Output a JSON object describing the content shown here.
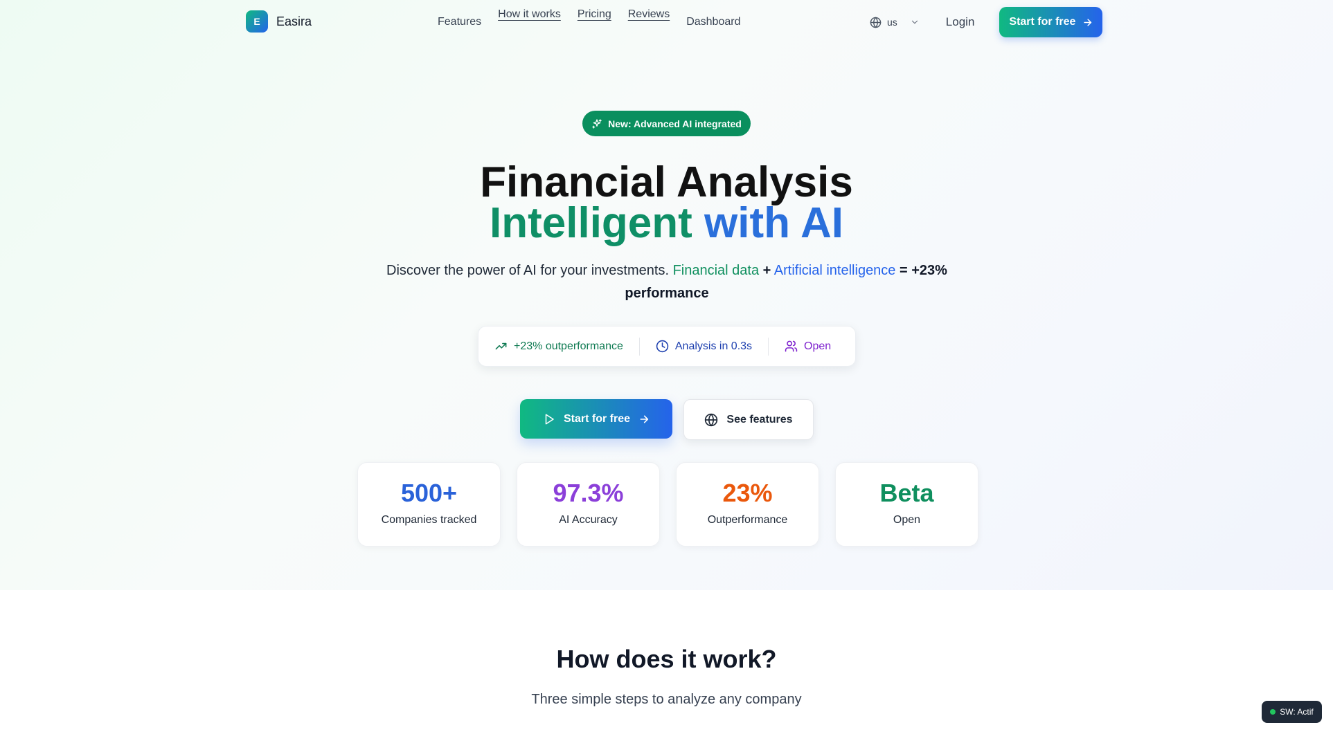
{
  "nav": {
    "brand_initial": "E",
    "brand_name": "Easira",
    "links": [
      {
        "label": "Features"
      },
      {
        "label": "How it works"
      },
      {
        "label": "Pricing"
      },
      {
        "label": "Reviews"
      },
      {
        "label": "Dashboard"
      }
    ],
    "language": "us",
    "login_label": "Login",
    "cta_label": "Start for free"
  },
  "hero": {
    "badge_label": "New: Advanced AI integrated",
    "title_line1": "Financial Analysis",
    "title_line2_part1": "Intelligent",
    "title_line2_part2": "with AI",
    "subtitle_prefix": "Discover the power of AI for your investments.",
    "subtitle_financial": "Financial data",
    "subtitle_plus": "+",
    "subtitle_ai": "Artificial intelligence",
    "subtitle_result": "= +23% performance",
    "pills": [
      {
        "label": "+23% outperformance",
        "icon": "trending-up-icon"
      },
      {
        "label": "Analysis in 0.3s",
        "icon": "clock-icon"
      },
      {
        "label": "Open",
        "icon": "users-icon"
      }
    ],
    "primary_cta": "Start for free",
    "secondary_cta": "See features"
  },
  "stats": [
    {
      "value": "500+",
      "label": "Companies tracked",
      "color": "#2a62d9"
    },
    {
      "value": "97.3%",
      "label": "AI Accuracy",
      "color": "#8b3fd9"
    },
    {
      "value": "23%",
      "label": "Outperformance",
      "color": "#ea580c"
    },
    {
      "value": "Beta",
      "label": "Open",
      "color": "#0f8f5e"
    }
  ],
  "how": {
    "title": "How does it work?",
    "subtitle": "Three simple steps to analyze any company"
  },
  "service_worker": {
    "label": "SW: Actif"
  },
  "colors": {
    "accent_green": "#10b981",
    "accent_blue": "#2563eb",
    "badge_green": "#0a8f5e"
  }
}
